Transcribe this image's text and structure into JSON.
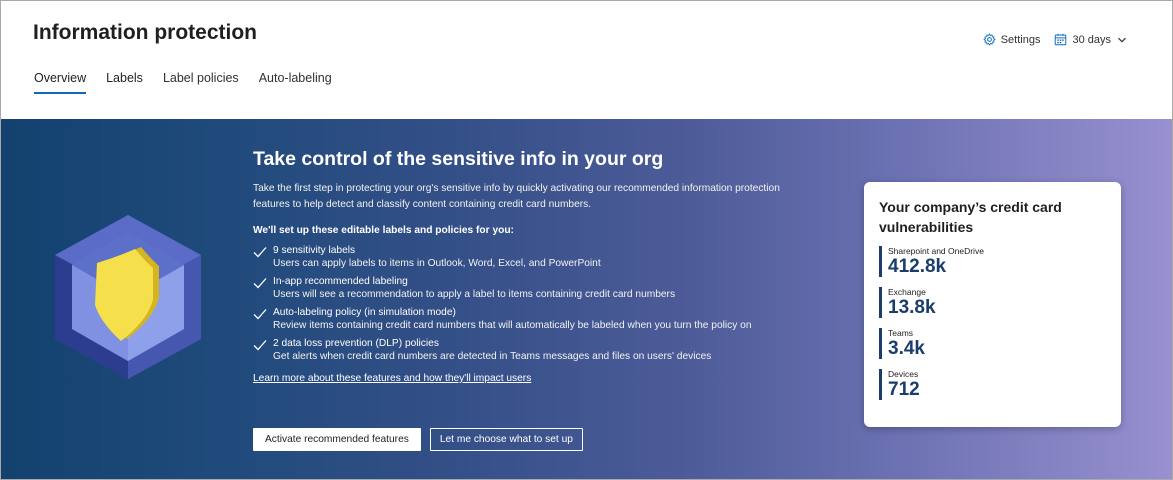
{
  "header": {
    "title": "Information protection",
    "tabs": [
      {
        "label": "Overview"
      },
      {
        "label": "Labels"
      },
      {
        "label": "Label policies"
      },
      {
        "label": "Auto-labeling"
      }
    ],
    "settings_label": "Settings",
    "date_range_label": "30 days"
  },
  "hero": {
    "title": "Take control of the sensitive info in your org",
    "description": "Take the first step in protecting your org's sensitive info by quickly activating our recommended information protection features to help detect and classify content containing credit card numbers.",
    "subhead": "We'll set up these editable labels and policies for you:",
    "features": [
      {
        "title": "9 sensitivity labels",
        "desc": "Users can apply labels to items in Outlook, Word, Excel, and PowerPoint"
      },
      {
        "title": "In-app recommended labeling",
        "desc": "Users will see a recommendation to apply a label to items containing credit card numbers"
      },
      {
        "title": "Auto-labeling policy (in simulation mode)",
        "desc": "Review items containing credit card numbers that will automatically be labeled when you turn the policy on"
      },
      {
        "title": "2 data loss prevention (DLP) policies",
        "desc": "Get alerts when credit card numbers are detected in Teams messages and files on users' devices"
      }
    ],
    "learn_link": "Learn more about these features and how they'll impact users",
    "primary_button": "Activate recommended features",
    "secondary_button": "Let me choose what to set up"
  },
  "card": {
    "title": "Your company’s credit card vulnerabilities",
    "metrics": [
      {
        "label": "Sharepoint and OneDrive",
        "value": "412.8k"
      },
      {
        "label": "Exchange",
        "value": "13.8k"
      },
      {
        "label": "Teams",
        "value": "3.4k"
      },
      {
        "label": "Devices",
        "value": "712"
      }
    ]
  },
  "colors": {
    "accent": "#0f6cbd",
    "metric_value": "#1b3d6b",
    "hero_start": "#13426f",
    "hero_end": "#9890d0",
    "shield_yellow": "#f5e04c"
  },
  "icons": [
    "gear-icon",
    "calendar-icon",
    "chevron-down-icon",
    "checkmark-icon",
    "shield-icon"
  ]
}
